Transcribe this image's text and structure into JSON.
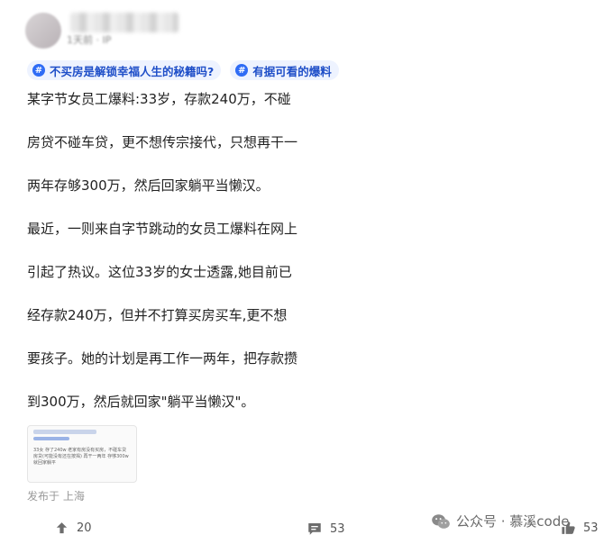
{
  "author": {
    "meta": "1天前 · IP"
  },
  "topics": [
    {
      "label": "不买房是解锁幸福人生的秘籍吗?"
    },
    {
      "label": "有据可看的爆料"
    }
  ],
  "paragraphs": [
    "某字节女员工爆料:33岁，存款240万，不碰",
    "房贷不碰车贷，更不想传宗接代，只想再干一",
    "两年存够300万，然后回家躺平当懒汉。",
    "最近，一则来自字节跳动的女员工爆料在网上",
    "引起了热议。这位33岁的女士透露,她目前已",
    "经存款240万，但并不打算买房买车,更不想",
    "要孩子。她的计划是再工作一两年，把存款攒",
    "到300万，然后就回家\"躺平当懒汉\"。"
  ],
  "thumbnail": {
    "text": "33女 存了240w 老家有房没有买房，不碰车贷房贷(可能没有还在按揭) 再干一两年 存够300w就回家躺平"
  },
  "location": "发布于 上海",
  "actions": {
    "share_count": "20",
    "comment_count": "53",
    "like_count": "53"
  },
  "watermark": "公众号 · 慕溪code",
  "colors": {
    "topic_text": "#1f4fc8",
    "topic_bg": "#eef3ff",
    "accent": "#2f6cf5"
  },
  "icons": [
    "share-icon",
    "comment-icon",
    "like-icon",
    "wechat-icon",
    "hash-icon"
  ]
}
